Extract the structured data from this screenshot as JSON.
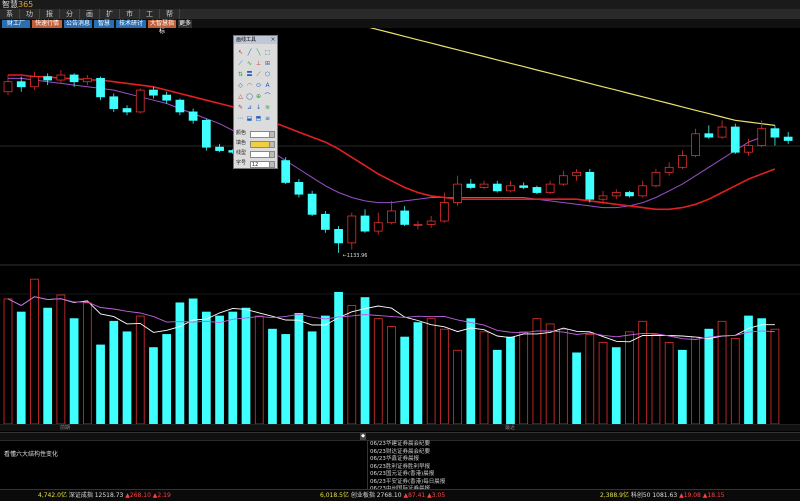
{
  "app": {
    "logo_text": "智慧",
    "logo_num": "365"
  },
  "menu": [
    "系",
    "功",
    "报",
    "分",
    "画",
    "扩",
    "市",
    "工",
    "帮"
  ],
  "tabs": [
    {
      "label": "财工厂",
      "color": "#2a6db0"
    },
    {
      "label": "快速行情",
      "color": "#c0603a"
    },
    {
      "label": "公告消息",
      "color": "#2a6db0"
    },
    {
      "label": "智慧",
      "color": "#2a6db0"
    },
    {
      "label": "技术研讨",
      "color": "#2a6db0"
    },
    {
      "label": "大智慧指标",
      "color": "#c0603a"
    },
    {
      "label": "更多",
      "color": "#333333"
    }
  ],
  "toolbox": {
    "title": "画线工具",
    "close": "×",
    "icons": [
      "↖",
      "╱",
      "╲",
      "⬚",
      "⟋",
      "∿",
      "⊥",
      "⊞",
      "⇅",
      "〓",
      "⟋",
      "⬡",
      "◇",
      "◠",
      "⬭",
      "A",
      "△",
      "◯",
      "⊕",
      "⌒",
      "✎",
      "⊿",
      "↓",
      "≋",
      "⋯",
      "⬓",
      "⬒",
      "≡"
    ],
    "rows": [
      {
        "label": "颜色",
        "value": ""
      },
      {
        "label": "填色",
        "value": ""
      },
      {
        "label": "线型",
        "value": ""
      },
      {
        "label": "字号",
        "value": "12"
      }
    ]
  },
  "annotation": "1133.96",
  "scroll": {
    "left": "前期",
    "mid": "最近",
    "right": ""
  },
  "lower": {
    "headers": [
      "",
      "",
      ""
    ],
    "article": "看懂六大结构性变化",
    "news": [
      {
        "date": "06/23",
        "text": "华建证券晨会纪要"
      },
      {
        "date": "06/23",
        "text": "财达证券晨会纪要"
      },
      {
        "date": "06/23",
        "text": "华鑫证券晨报"
      },
      {
        "date": "06/23",
        "text": "胜利证券胜利早报"
      },
      {
        "date": "06/23",
        "text": "国元证券(香港)晨报"
      },
      {
        "date": "06/23",
        "text": "平安证券(香港)每日晨报"
      },
      {
        "date": "06/23",
        "text": "中州国际证券晨报"
      }
    ]
  },
  "status": [
    {
      "val": "4,742.0亿",
      "name": "深证成指",
      "num": "12518.73",
      "chg": "▲268.10",
      "pct": "▲2.19"
    },
    {
      "val": "6,018.5亿",
      "name": "创业板指",
      "num": "2768.10",
      "chg": "▲87.41",
      "pct": "▲3.05"
    },
    {
      "val": "2,388.9亿",
      "name": "科创50",
      "num": "1081.63",
      "chg": "▲19.08",
      "pct": "▲18.15"
    }
  ],
  "chart_data": {
    "type": "candlestick",
    "candles": [
      {
        "o": 2,
        "c": 8,
        "h": 12,
        "l": 0
      },
      {
        "o": 8,
        "c": 5,
        "h": 11,
        "l": 2
      },
      {
        "o": 5,
        "c": 11,
        "h": 14,
        "l": 3
      },
      {
        "o": 11,
        "c": 9,
        "h": 13,
        "l": 6
      },
      {
        "o": 9,
        "c": 12,
        "h": 15,
        "l": 7
      },
      {
        "o": 12,
        "c": 8,
        "h": 13,
        "l": 5
      },
      {
        "o": 8,
        "c": 10,
        "h": 12,
        "l": 6
      },
      {
        "o": 10,
        "c": -1,
        "h": 11,
        "l": -3
      },
      {
        "o": -1,
        "c": -8,
        "h": 1,
        "l": -10
      },
      {
        "o": -8,
        "c": -10,
        "h": -6,
        "l": -12
      },
      {
        "o": -10,
        "c": 3,
        "h": 4,
        "l": -11
      },
      {
        "o": 3,
        "c": 0,
        "h": 5,
        "l": -2
      },
      {
        "o": 0,
        "c": -3,
        "h": 2,
        "l": -5
      },
      {
        "o": -3,
        "c": -10,
        "h": -2,
        "l": -12
      },
      {
        "o": -10,
        "c": -15,
        "h": -8,
        "l": -17
      },
      {
        "o": -15,
        "c": -31,
        "h": -14,
        "l": -33
      },
      {
        "o": -31,
        "c": -33,
        "h": -29,
        "l": -34
      },
      {
        "o": -33,
        "c": -34,
        "h": -32,
        "l": -35
      },
      {
        "o": -34,
        "c": -40,
        "h": -33,
        "l": -42
      },
      {
        "o": -40,
        "c": -38,
        "h": -35,
        "l": -41
      },
      {
        "o": -38,
        "c": -39,
        "h": -36,
        "l": -40
      },
      {
        "o": -39,
        "c": -52,
        "h": -37,
        "l": -53
      },
      {
        "o": -52,
        "c": -59,
        "h": -50,
        "l": -61
      },
      {
        "o": -59,
        "c": -71,
        "h": -57,
        "l": -72
      },
      {
        "o": -71,
        "c": -80,
        "h": -69,
        "l": -82
      },
      {
        "o": -80,
        "c": -88,
        "h": -78,
        "l": -94
      },
      {
        "o": -88,
        "c": -72,
        "h": -70,
        "l": -92
      },
      {
        "o": -72,
        "c": -81,
        "h": -68,
        "l": -82
      },
      {
        "o": -81,
        "c": -76,
        "h": -70,
        "l": -83
      },
      {
        "o": -76,
        "c": -69,
        "h": -63,
        "l": -77
      },
      {
        "o": -69,
        "c": -77,
        "h": -66,
        "l": -78
      },
      {
        "o": -77,
        "c": -77,
        "h": -75,
        "l": -80
      },
      {
        "o": -77,
        "c": -75,
        "h": -72,
        "l": -79
      },
      {
        "o": -75,
        "c": -64,
        "h": -58,
        "l": -76
      },
      {
        "o": -64,
        "c": -53,
        "h": -48,
        "l": -66
      },
      {
        "o": -53,
        "c": -55,
        "h": -50,
        "l": -56
      },
      {
        "o": -55,
        "c": -53,
        "h": -51,
        "l": -56
      },
      {
        "o": -53,
        "c": -57,
        "h": -51,
        "l": -58
      },
      {
        "o": -57,
        "c": -54,
        "h": -51,
        "l": -58
      },
      {
        "o": -54,
        "c": -55,
        "h": -52,
        "l": -56
      },
      {
        "o": -55,
        "c": -58,
        "h": -54,
        "l": -59
      },
      {
        "o": -58,
        "c": -53,
        "h": -51,
        "l": -59
      },
      {
        "o": -53,
        "c": -48,
        "h": -45,
        "l": -54
      },
      {
        "o": -48,
        "c": -46,
        "h": -44,
        "l": -51
      },
      {
        "o": -46,
        "c": -62,
        "h": -44,
        "l": -64
      },
      {
        "o": -62,
        "c": -60,
        "h": -57,
        "l": -65
      },
      {
        "o": -60,
        "c": -58,
        "h": -56,
        "l": -62
      },
      {
        "o": -58,
        "c": -60,
        "h": -57,
        "l": -61
      },
      {
        "o": -60,
        "c": -54,
        "h": -51,
        "l": -61
      },
      {
        "o": -54,
        "c": -46,
        "h": -44,
        "l": -55
      },
      {
        "o": -46,
        "c": -43,
        "h": -40,
        "l": -48
      },
      {
        "o": -43,
        "c": -36,
        "h": -33,
        "l": -44
      },
      {
        "o": -36,
        "c": -23,
        "h": -20,
        "l": -37
      },
      {
        "o": -23,
        "c": -25,
        "h": -18,
        "l": -26
      },
      {
        "o": -25,
        "c": -19,
        "h": -15,
        "l": -26
      },
      {
        "o": -19,
        "c": -34,
        "h": -17,
        "l": -35
      },
      {
        "o": -34,
        "c": -30,
        "h": -26,
        "l": -36
      },
      {
        "o": -30,
        "c": -20,
        "h": -15,
        "l": -31
      },
      {
        "o": -20,
        "c": -25,
        "h": -18,
        "l": -30
      },
      {
        "o": -25,
        "c": -27,
        "h": -22,
        "l": -29
      }
    ],
    "ma_yellow": [
      95,
      93,
      91,
      89,
      87,
      85,
      83,
      81,
      79,
      77,
      75,
      73,
      71,
      69,
      67,
      65,
      63,
      61,
      59,
      57,
      55,
      53,
      51,
      49,
      47,
      45,
      43,
      41,
      39,
      37,
      35,
      33,
      31,
      29,
      27,
      25,
      23,
      21,
      19,
      17,
      15,
      13,
      11,
      9,
      7,
      5,
      3,
      1,
      -1,
      -3,
      -5,
      -7,
      -9,
      -11,
      -13,
      -15,
      -16,
      -17,
      -18
    ],
    "ma_red": [
      12,
      12,
      11,
      11,
      10,
      10,
      9,
      9,
      8,
      7,
      6,
      5,
      3,
      1,
      -1,
      -3,
      -5,
      -7,
      -10,
      -13,
      -16,
      -19,
      -22,
      -25,
      -28,
      -32,
      -37,
      -42,
      -47,
      -51,
      -55,
      -58,
      -60,
      -61,
      -62,
      -62,
      -62,
      -62,
      -62,
      -62,
      -62,
      -62,
      -62,
      -62,
      -63,
      -64,
      -65,
      -66,
      -67,
      -68,
      -68,
      -67,
      -65,
      -62,
      -58,
      -54,
      -50,
      -47,
      -44
    ],
    "ma_purple": [
      10,
      10,
      9,
      8,
      7,
      6,
      5,
      4,
      3,
      1,
      -1,
      -3,
      -5,
      -8,
      -11,
      -14,
      -17,
      -21,
      -25,
      -29,
      -34,
      -39,
      -44,
      -49,
      -54,
      -58,
      -61,
      -63,
      -64,
      -64,
      -63,
      -62,
      -61,
      -61,
      -61,
      -61,
      -61,
      -61,
      -61,
      -61,
      -62,
      -63,
      -64,
      -65,
      -66,
      -67,
      -67,
      -66,
      -64,
      -61,
      -57,
      -53,
      -48,
      -43,
      -38,
      -33,
      -28,
      -25
    ],
    "volume": [
      95,
      85,
      110,
      88,
      98,
      80,
      92,
      60,
      78,
      70,
      82,
      58,
      68,
      92,
      95,
      85,
      82,
      85,
      88,
      82,
      72,
      68,
      84,
      70,
      82,
      100,
      90,
      96,
      80,
      74,
      66,
      77,
      80,
      72,
      56,
      80,
      70,
      56,
      66,
      70,
      80,
      76,
      72,
      54,
      68,
      62,
      58,
      70,
      78,
      68,
      62,
      56,
      66,
      72,
      78,
      65,
      82,
      80,
      72
    ],
    "vol_up": [
      true,
      false,
      true,
      false,
      true,
      false,
      true,
      false,
      false,
      false,
      true,
      false,
      false,
      false,
      false,
      false,
      false,
      false,
      false,
      true,
      false,
      false,
      false,
      false,
      false,
      false,
      true,
      false,
      true,
      true,
      false,
      false,
      true,
      true,
      true,
      false,
      true,
      false,
      false,
      true,
      true,
      true,
      true,
      false,
      true,
      true,
      false,
      true,
      true,
      true,
      true,
      false,
      true,
      false,
      true,
      true,
      false,
      false,
      true
    ],
    "prices_range": [
      -100,
      40
    ],
    "annotation_index": 25
  }
}
